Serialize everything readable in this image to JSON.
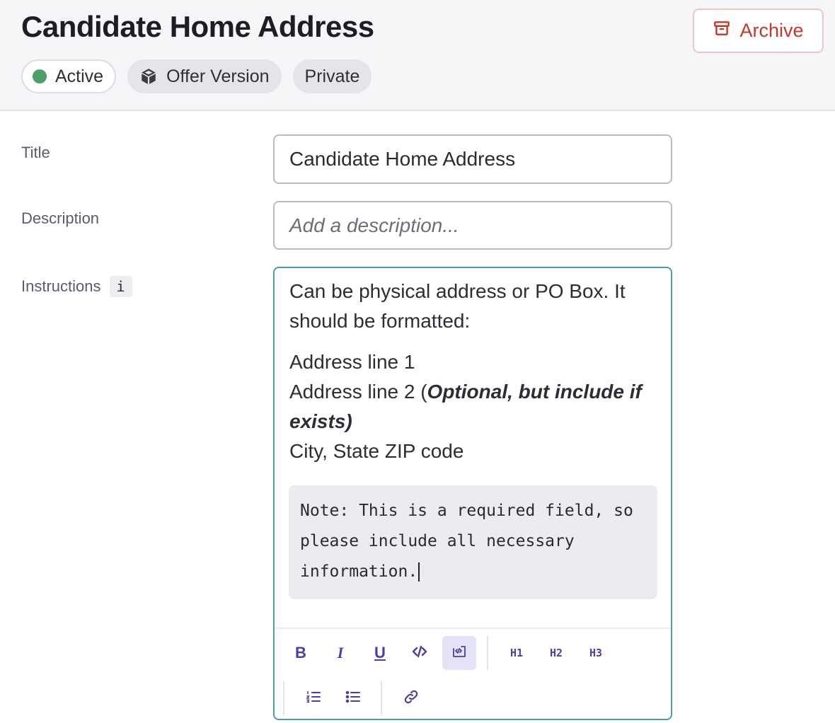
{
  "header": {
    "title": "Candidate Home Address",
    "archive_label": "Archive",
    "badges": [
      {
        "label": "Active",
        "status_color": "#4e9e6a"
      },
      {
        "label": "Offer Version",
        "icon": "cube-icon"
      },
      {
        "label": "Private"
      }
    ]
  },
  "form": {
    "title_label": "Title",
    "title_value": "Candidate Home Address",
    "description_label": "Description",
    "description_placeholder": "Add a description...",
    "instructions_label": "Instructions",
    "instructions_info": "i"
  },
  "editor": {
    "para1": "Can be physical address or PO Box. It should be formatted:",
    "line1": "Address line 1",
    "line2_prefix": "Address line 2 (",
    "line2_bold": "Optional, but include if exists)",
    "line3": "City, State ZIP code",
    "code": "Note: This is a required field, so please include all necessary information.",
    "toolbar": {
      "bold": "B",
      "italic": "I",
      "underline": "U",
      "h1": "H1",
      "h2": "H2",
      "h3": "H3"
    }
  },
  "colors": {
    "accent": "#4b3fa0",
    "archive": "#c0392b",
    "editor_focus": "#4f9ba6"
  }
}
